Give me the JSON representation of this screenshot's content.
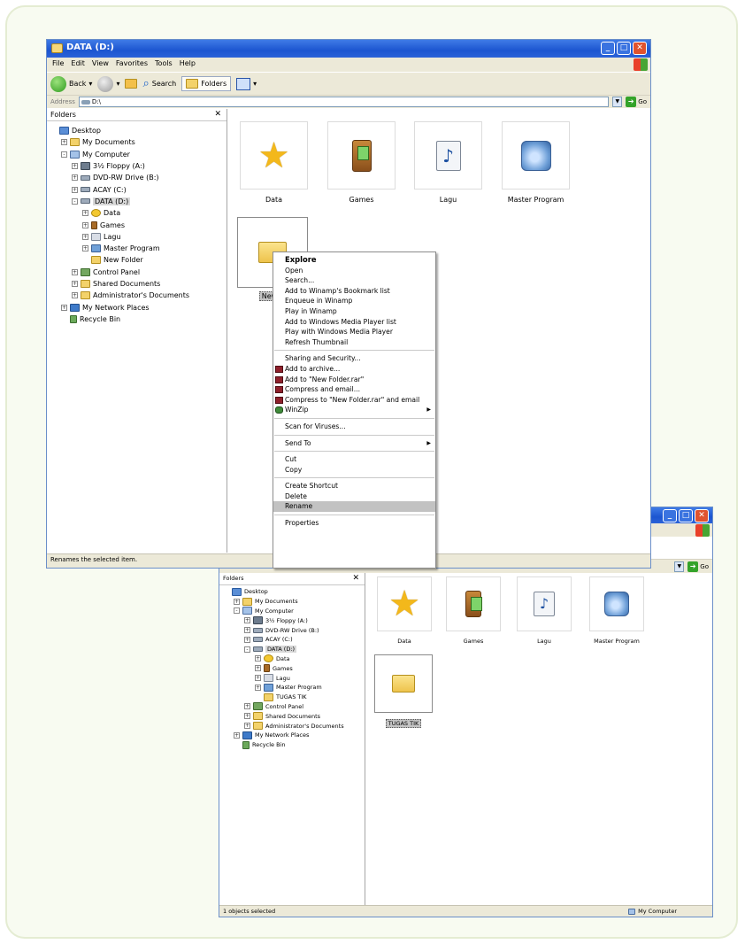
{
  "window1": {
    "title": "DATA (D:)",
    "menu": [
      "File",
      "Edit",
      "View",
      "Favorites",
      "Tools",
      "Help"
    ],
    "toolbar": {
      "back": "Back",
      "search": "Search",
      "folders": "Folders"
    },
    "address": {
      "label": "Address",
      "value": "D:\\",
      "go": "Go"
    },
    "folders_title": "Folders",
    "tree": [
      {
        "label": "Desktop",
        "indent": 0,
        "exp": "",
        "icon": "desk"
      },
      {
        "label": "My Documents",
        "indent": 1,
        "exp": "+",
        "icon": "fold"
      },
      {
        "label": "My Computer",
        "indent": 1,
        "exp": "-",
        "icon": "comp"
      },
      {
        "label": "3½ Floppy (A:)",
        "indent": 2,
        "exp": "+",
        "icon": "floppy"
      },
      {
        "label": "DVD-RW Drive (B:)",
        "indent": 2,
        "exp": "+",
        "icon": "drive"
      },
      {
        "label": "ACAY (C:)",
        "indent": 2,
        "exp": "+",
        "icon": "drive"
      },
      {
        "label": "DATA (D:)",
        "indent": 2,
        "exp": "-",
        "icon": "drive",
        "sel": true
      },
      {
        "label": "Data",
        "indent": 3,
        "exp": "+",
        "icon": "star"
      },
      {
        "label": "Games",
        "indent": 3,
        "exp": "+",
        "icon": "game"
      },
      {
        "label": "Lagu",
        "indent": 3,
        "exp": "+",
        "icon": "music"
      },
      {
        "label": "Master Program",
        "indent": 3,
        "exp": "+",
        "icon": "prog"
      },
      {
        "label": "New Folder",
        "indent": 3,
        "exp": "",
        "icon": "fold"
      },
      {
        "label": "Control Panel",
        "indent": 2,
        "exp": "+",
        "icon": "cp"
      },
      {
        "label": "Shared Documents",
        "indent": 2,
        "exp": "+",
        "icon": "fold"
      },
      {
        "label": "Administrator's Documents",
        "indent": 2,
        "exp": "+",
        "icon": "fold"
      },
      {
        "label": "My Network Places",
        "indent": 1,
        "exp": "+",
        "icon": "net"
      },
      {
        "label": "Recycle Bin",
        "indent": 1,
        "exp": "",
        "icon": "bin"
      }
    ],
    "tiles": {
      "data": "Data",
      "games": "Games",
      "lagu": "Lagu",
      "master": "Master Program",
      "new_partial": "New F"
    },
    "status": "Renames the selected item."
  },
  "context_menu": [
    {
      "label": "Explore",
      "bold": true
    },
    {
      "label": "Open"
    },
    {
      "label": "Search..."
    },
    {
      "label": "Add to Winamp's Bookmark list"
    },
    {
      "label": "Enqueue in Winamp"
    },
    {
      "label": "Play in Winamp"
    },
    {
      "label": "Add to Windows Media Player list"
    },
    {
      "label": "Play with Windows Media Player"
    },
    {
      "label": "Refresh Thumbnail"
    },
    {
      "sep": true
    },
    {
      "label": "Sharing and Security..."
    },
    {
      "label": "Add to archive...",
      "icon": "rar"
    },
    {
      "label": "Add to \"New Folder.rar\"",
      "icon": "rar"
    },
    {
      "label": "Compress and email...",
      "icon": "rar"
    },
    {
      "label": "Compress to \"New Folder.rar\" and email",
      "icon": "rar"
    },
    {
      "label": "WinZip",
      "icon": "zip",
      "arrow": true
    },
    {
      "sep": true
    },
    {
      "label": "Scan for Viruses..."
    },
    {
      "sep": true
    },
    {
      "label": "Send To",
      "arrow": true
    },
    {
      "sep": true
    },
    {
      "label": "Cut"
    },
    {
      "label": "Copy"
    },
    {
      "sep": true
    },
    {
      "label": "Create Shortcut"
    },
    {
      "label": "Delete"
    },
    {
      "label": "Rename",
      "hover": true
    },
    {
      "sep": true
    },
    {
      "label": "Properties"
    }
  ],
  "window2": {
    "go": "Go",
    "folders_title": "Folders",
    "tree": [
      {
        "label": "Desktop",
        "indent": 0,
        "exp": "",
        "icon": "desk"
      },
      {
        "label": "My Documents",
        "indent": 1,
        "exp": "+",
        "icon": "fold"
      },
      {
        "label": "My Computer",
        "indent": 1,
        "exp": "-",
        "icon": "comp"
      },
      {
        "label": "3½ Floppy (A:)",
        "indent": 2,
        "exp": "+",
        "icon": "floppy"
      },
      {
        "label": "DVD-RW Drive (B:)",
        "indent": 2,
        "exp": "+",
        "icon": "drive"
      },
      {
        "label": "ACAY (C:)",
        "indent": 2,
        "exp": "+",
        "icon": "drive"
      },
      {
        "label": "DATA (D:)",
        "indent": 2,
        "exp": "-",
        "icon": "drive",
        "sel": true
      },
      {
        "label": "Data",
        "indent": 3,
        "exp": "+",
        "icon": "star"
      },
      {
        "label": "Games",
        "indent": 3,
        "exp": "+",
        "icon": "game"
      },
      {
        "label": "Lagu",
        "indent": 3,
        "exp": "+",
        "icon": "music"
      },
      {
        "label": "Master Program",
        "indent": 3,
        "exp": "+",
        "icon": "prog"
      },
      {
        "label": "TUGAS TIK",
        "indent": 3,
        "exp": "",
        "icon": "fold"
      },
      {
        "label": "Control Panel",
        "indent": 2,
        "exp": "+",
        "icon": "cp"
      },
      {
        "label": "Shared Documents",
        "indent": 2,
        "exp": "+",
        "icon": "fold"
      },
      {
        "label": "Administrator's Documents",
        "indent": 2,
        "exp": "+",
        "icon": "fold"
      },
      {
        "label": "My Network Places",
        "indent": 1,
        "exp": "+",
        "icon": "net"
      },
      {
        "label": "Recycle Bin",
        "indent": 1,
        "exp": "",
        "icon": "bin"
      }
    ],
    "tiles": {
      "data": "Data",
      "games": "Games",
      "lagu": "Lagu",
      "master": "Master Program",
      "tugas": "TUGAS TIK"
    },
    "status": "1 objects selected",
    "status_right": "My Computer"
  },
  "colors": {
    "titlebar": "#1c55d0",
    "menubar": "#ece9d8",
    "frame": "#e4ecd2",
    "selection": "#c4c4c4"
  }
}
